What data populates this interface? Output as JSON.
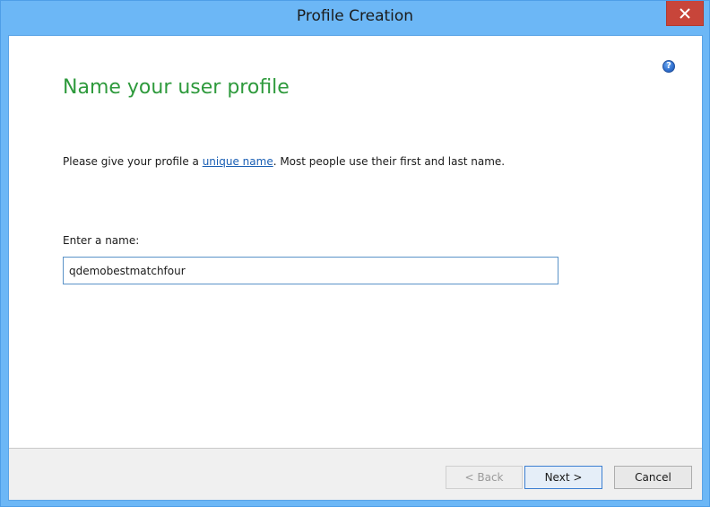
{
  "window": {
    "title": "Profile Creation",
    "close_label": "✕"
  },
  "page": {
    "heading": "Name your user profile",
    "instruction_prefix": "Please give your profile a ",
    "instruction_link": "unique name",
    "instruction_suffix": ".  Most people use their first and last name.",
    "field_label": "Enter a name:",
    "name_value": "qdemobestmatchfour",
    "help_glyph": "?"
  },
  "footer": {
    "back_label": "< Back",
    "next_label": "Next >",
    "cancel_label": "Cancel"
  },
  "colors": {
    "titlebar": "#6cb7f6",
    "heading": "#2e9a3c",
    "link": "#1a5fb4",
    "close": "#c8453a"
  }
}
